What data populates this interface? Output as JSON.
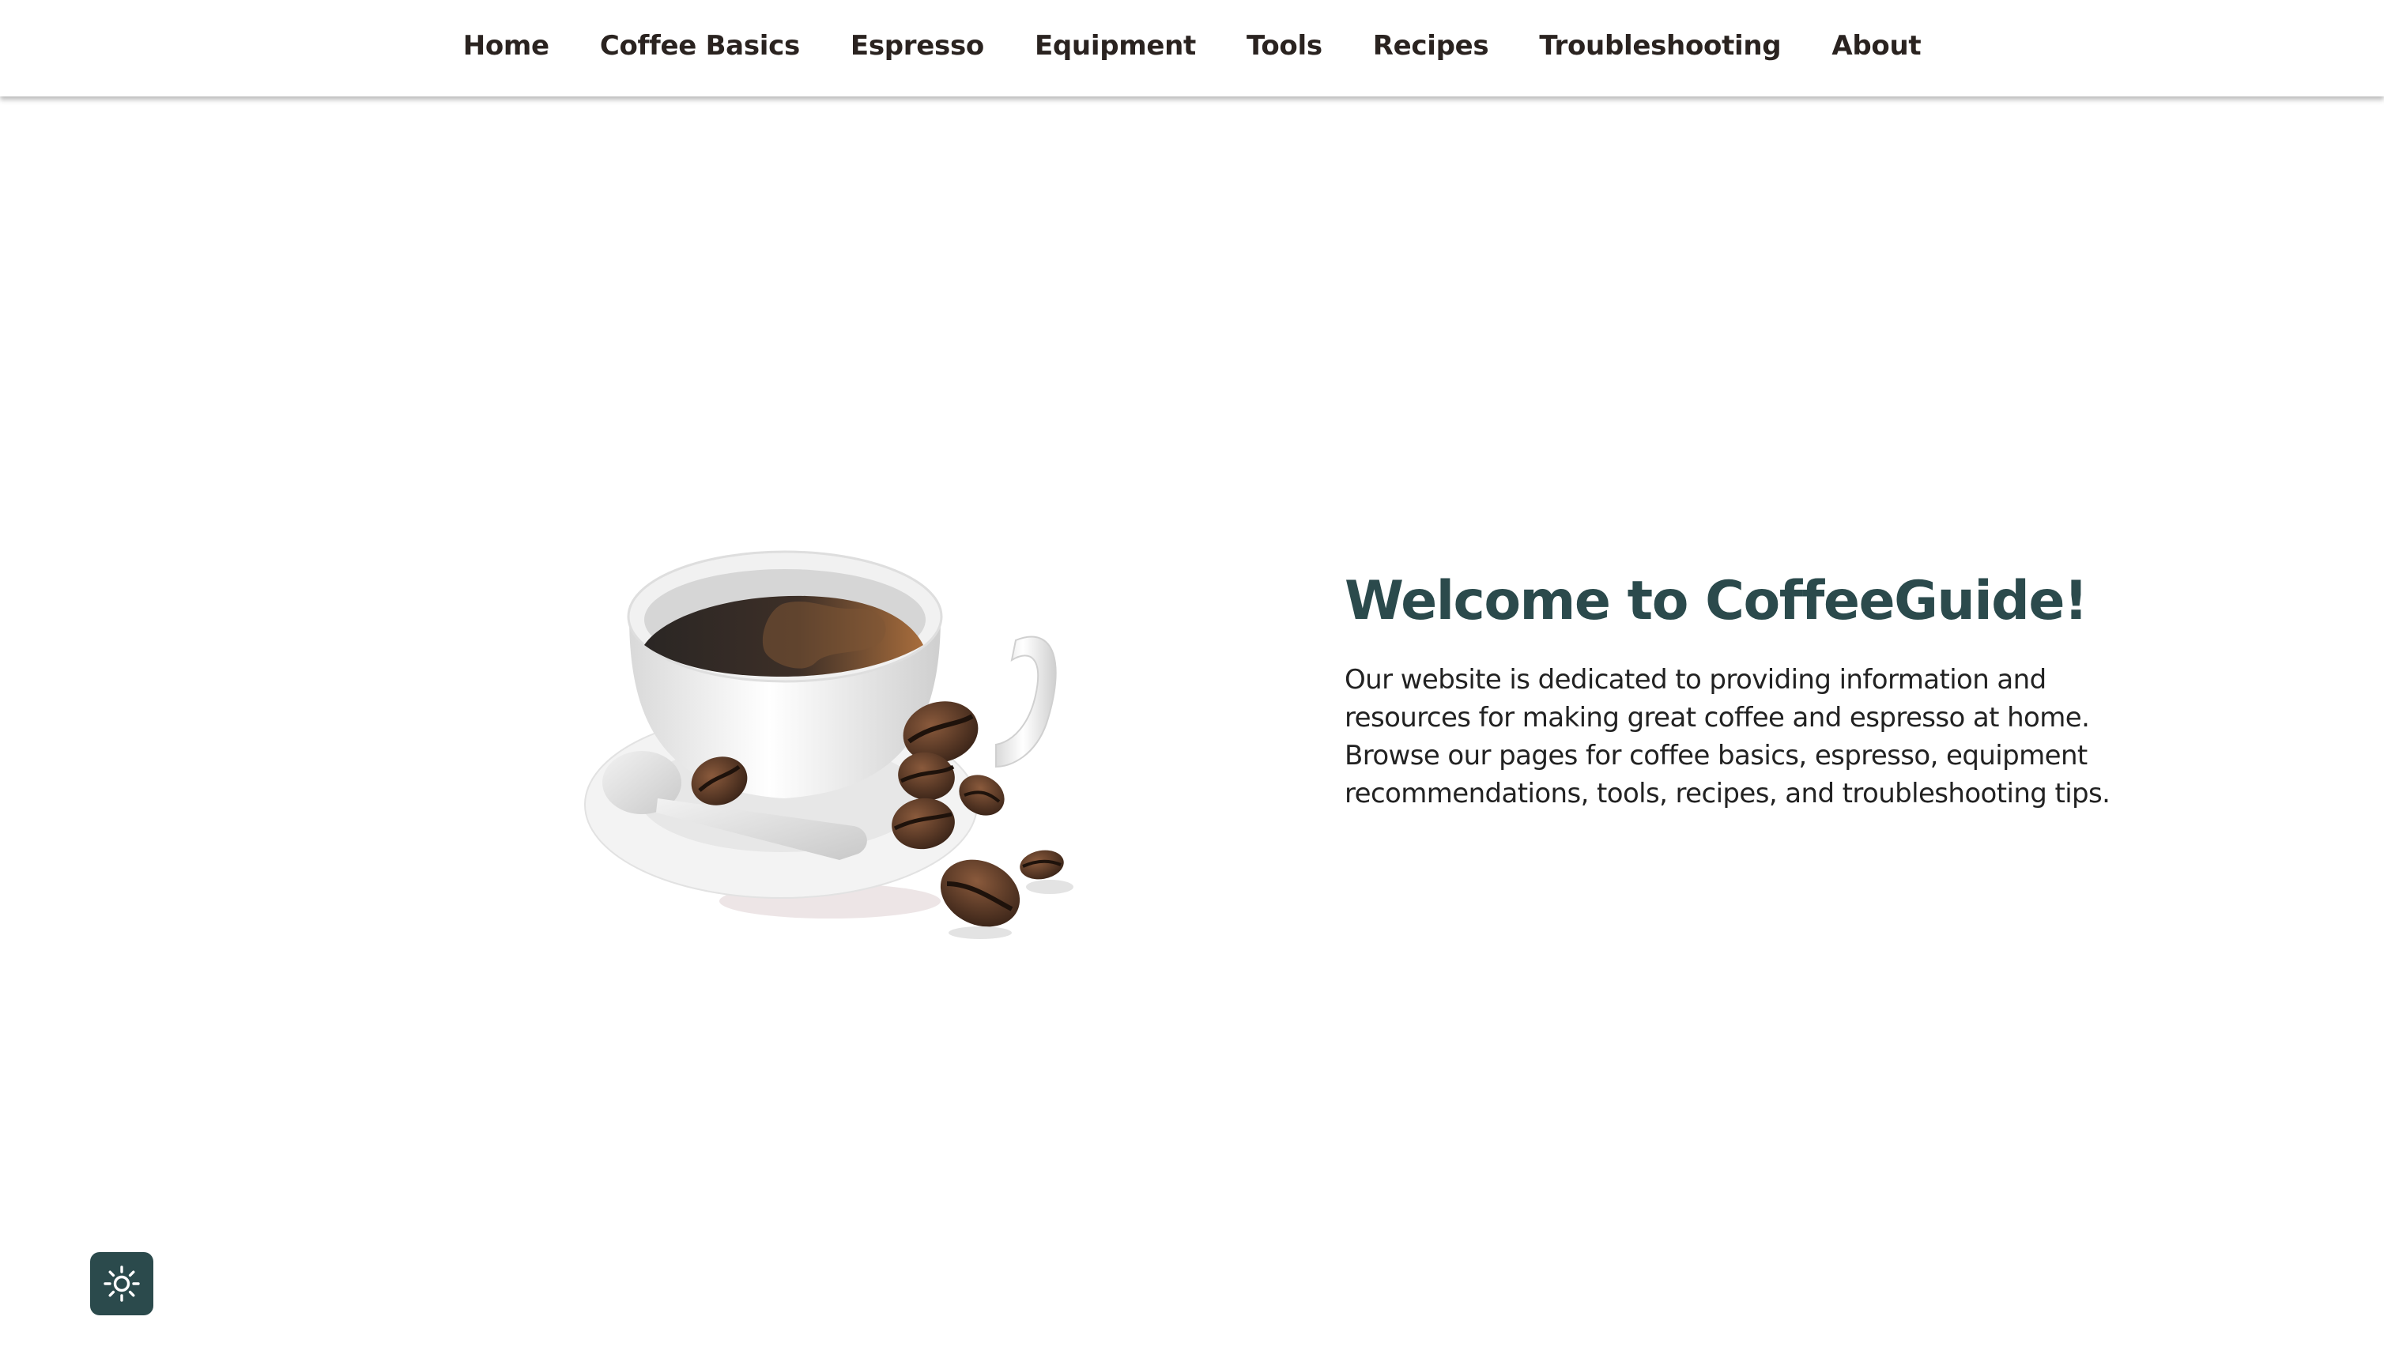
{
  "nav": {
    "items": [
      {
        "label": "Home"
      },
      {
        "label": "Coffee Basics"
      },
      {
        "label": "Espresso"
      },
      {
        "label": "Equipment"
      },
      {
        "label": "Tools"
      },
      {
        "label": "Recipes"
      },
      {
        "label": "Troubleshooting"
      },
      {
        "label": "About"
      }
    ]
  },
  "hero": {
    "title": "Welcome to CoffeeGuide!",
    "description": "Our website is dedicated to providing information and resources for making great coffee and espresso at home. Browse our pages for coffee basics, espresso, equipment recommendations, tools, recipes, and troubleshooting tips.",
    "image_icon": "coffee-cup-with-beans-illustration"
  },
  "theme_toggle": {
    "icon": "sun-icon"
  },
  "colors": {
    "nav_text": "#2a2320",
    "heading": "#2b4a4c",
    "body_text": "#222222",
    "toggle_bg": "#2b4a4c",
    "background": "#ffffff"
  }
}
